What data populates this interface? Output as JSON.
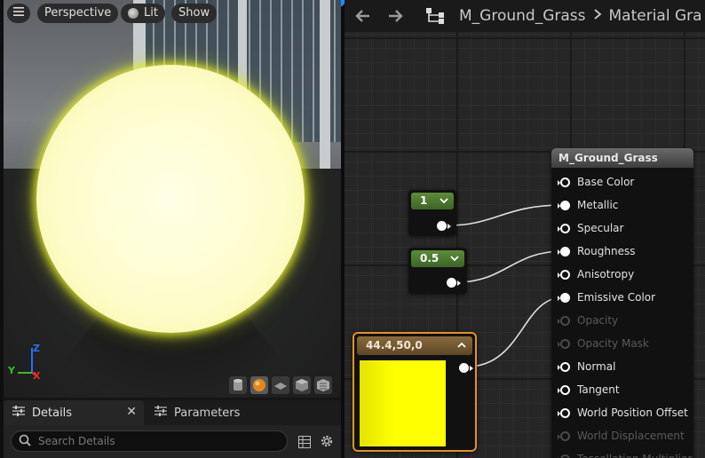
{
  "viewport": {
    "toolbar": {
      "menu_icon": "hamburger-icon",
      "perspective_label": "Perspective",
      "lit_label": "Lit",
      "show_label": "Show"
    },
    "axis": {
      "x": "X",
      "y": "Y",
      "z": "Z"
    },
    "preview_shapes": [
      "cylinder-icon",
      "sphere-icon",
      "plane-icon",
      "cube-icon",
      "custom-mesh-icon"
    ],
    "preview_color": "#fdfcc9"
  },
  "details": {
    "tabs": [
      {
        "label": "Details",
        "icon": "sliders-icon",
        "closable": true
      },
      {
        "label": "Parameters",
        "icon": "sliders-icon"
      }
    ],
    "search": {
      "placeholder": "Search Details"
    }
  },
  "graph": {
    "breadcrumb": [
      "M_Ground_Grass",
      "Material Gra"
    ],
    "nodes": {
      "constant_metallic": {
        "value": "1"
      },
      "constant_roughness": {
        "value": "0.5"
      },
      "vector": {
        "label": "44.4,50,0",
        "color": "#ffff00"
      }
    },
    "result": {
      "title": "M_Ground_Grass",
      "pins": [
        {
          "label": "Base Color",
          "connected": false,
          "enabled": true
        },
        {
          "label": "Metallic",
          "connected": true,
          "enabled": true
        },
        {
          "label": "Specular",
          "connected": false,
          "enabled": true
        },
        {
          "label": "Roughness",
          "connected": true,
          "enabled": true
        },
        {
          "label": "Anisotropy",
          "connected": false,
          "enabled": true
        },
        {
          "label": "Emissive Color",
          "connected": true,
          "enabled": true
        },
        {
          "label": "Opacity",
          "connected": false,
          "enabled": false
        },
        {
          "label": "Opacity Mask",
          "connected": false,
          "enabled": false
        },
        {
          "label": "Normal",
          "connected": false,
          "enabled": true
        },
        {
          "label": "Tangent",
          "connected": false,
          "enabled": true
        },
        {
          "label": "World Position Offset",
          "connected": false,
          "enabled": true
        },
        {
          "label": "World Displacement",
          "connected": false,
          "enabled": false
        },
        {
          "label": "Tessellation Multiplier",
          "connected": false,
          "enabled": false
        }
      ]
    }
  }
}
